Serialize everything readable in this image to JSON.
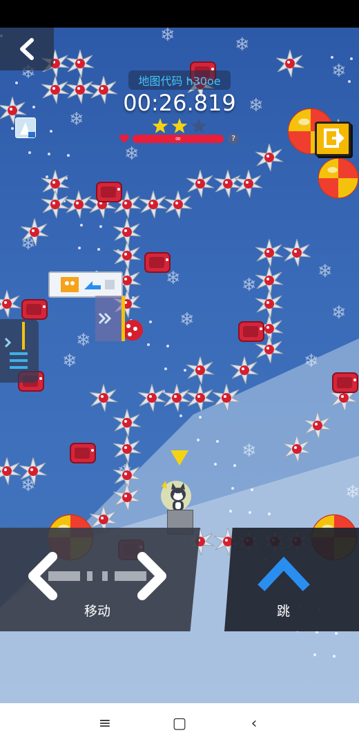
{
  "hud": {
    "map_code_label": "地图代码 h30oe",
    "timer": "00:26.819",
    "stars_earned": 2,
    "stars_total": 3,
    "health": "∞",
    "help_label": "?"
  },
  "controls": {
    "move_label": "移动",
    "jump_label": "跳"
  },
  "nav": {
    "menu_label": "≡",
    "home_label": "▢",
    "back_label": "‹"
  },
  "colors": {
    "background": "#3a6bb8",
    "accent_cyan": "#45c4f5",
    "health_red": "#e81e3a",
    "star_yellow": "#f5d313",
    "jump_blue": "#2a8ef0",
    "exit_yellow": "#f5b800"
  },
  "icons": {
    "back": "back-chevron-icon",
    "exit": "exit-door-icon",
    "menu": "side-menu-icon",
    "jump": "up-arrow-icon",
    "move": "left-right-arrows-icon"
  }
}
